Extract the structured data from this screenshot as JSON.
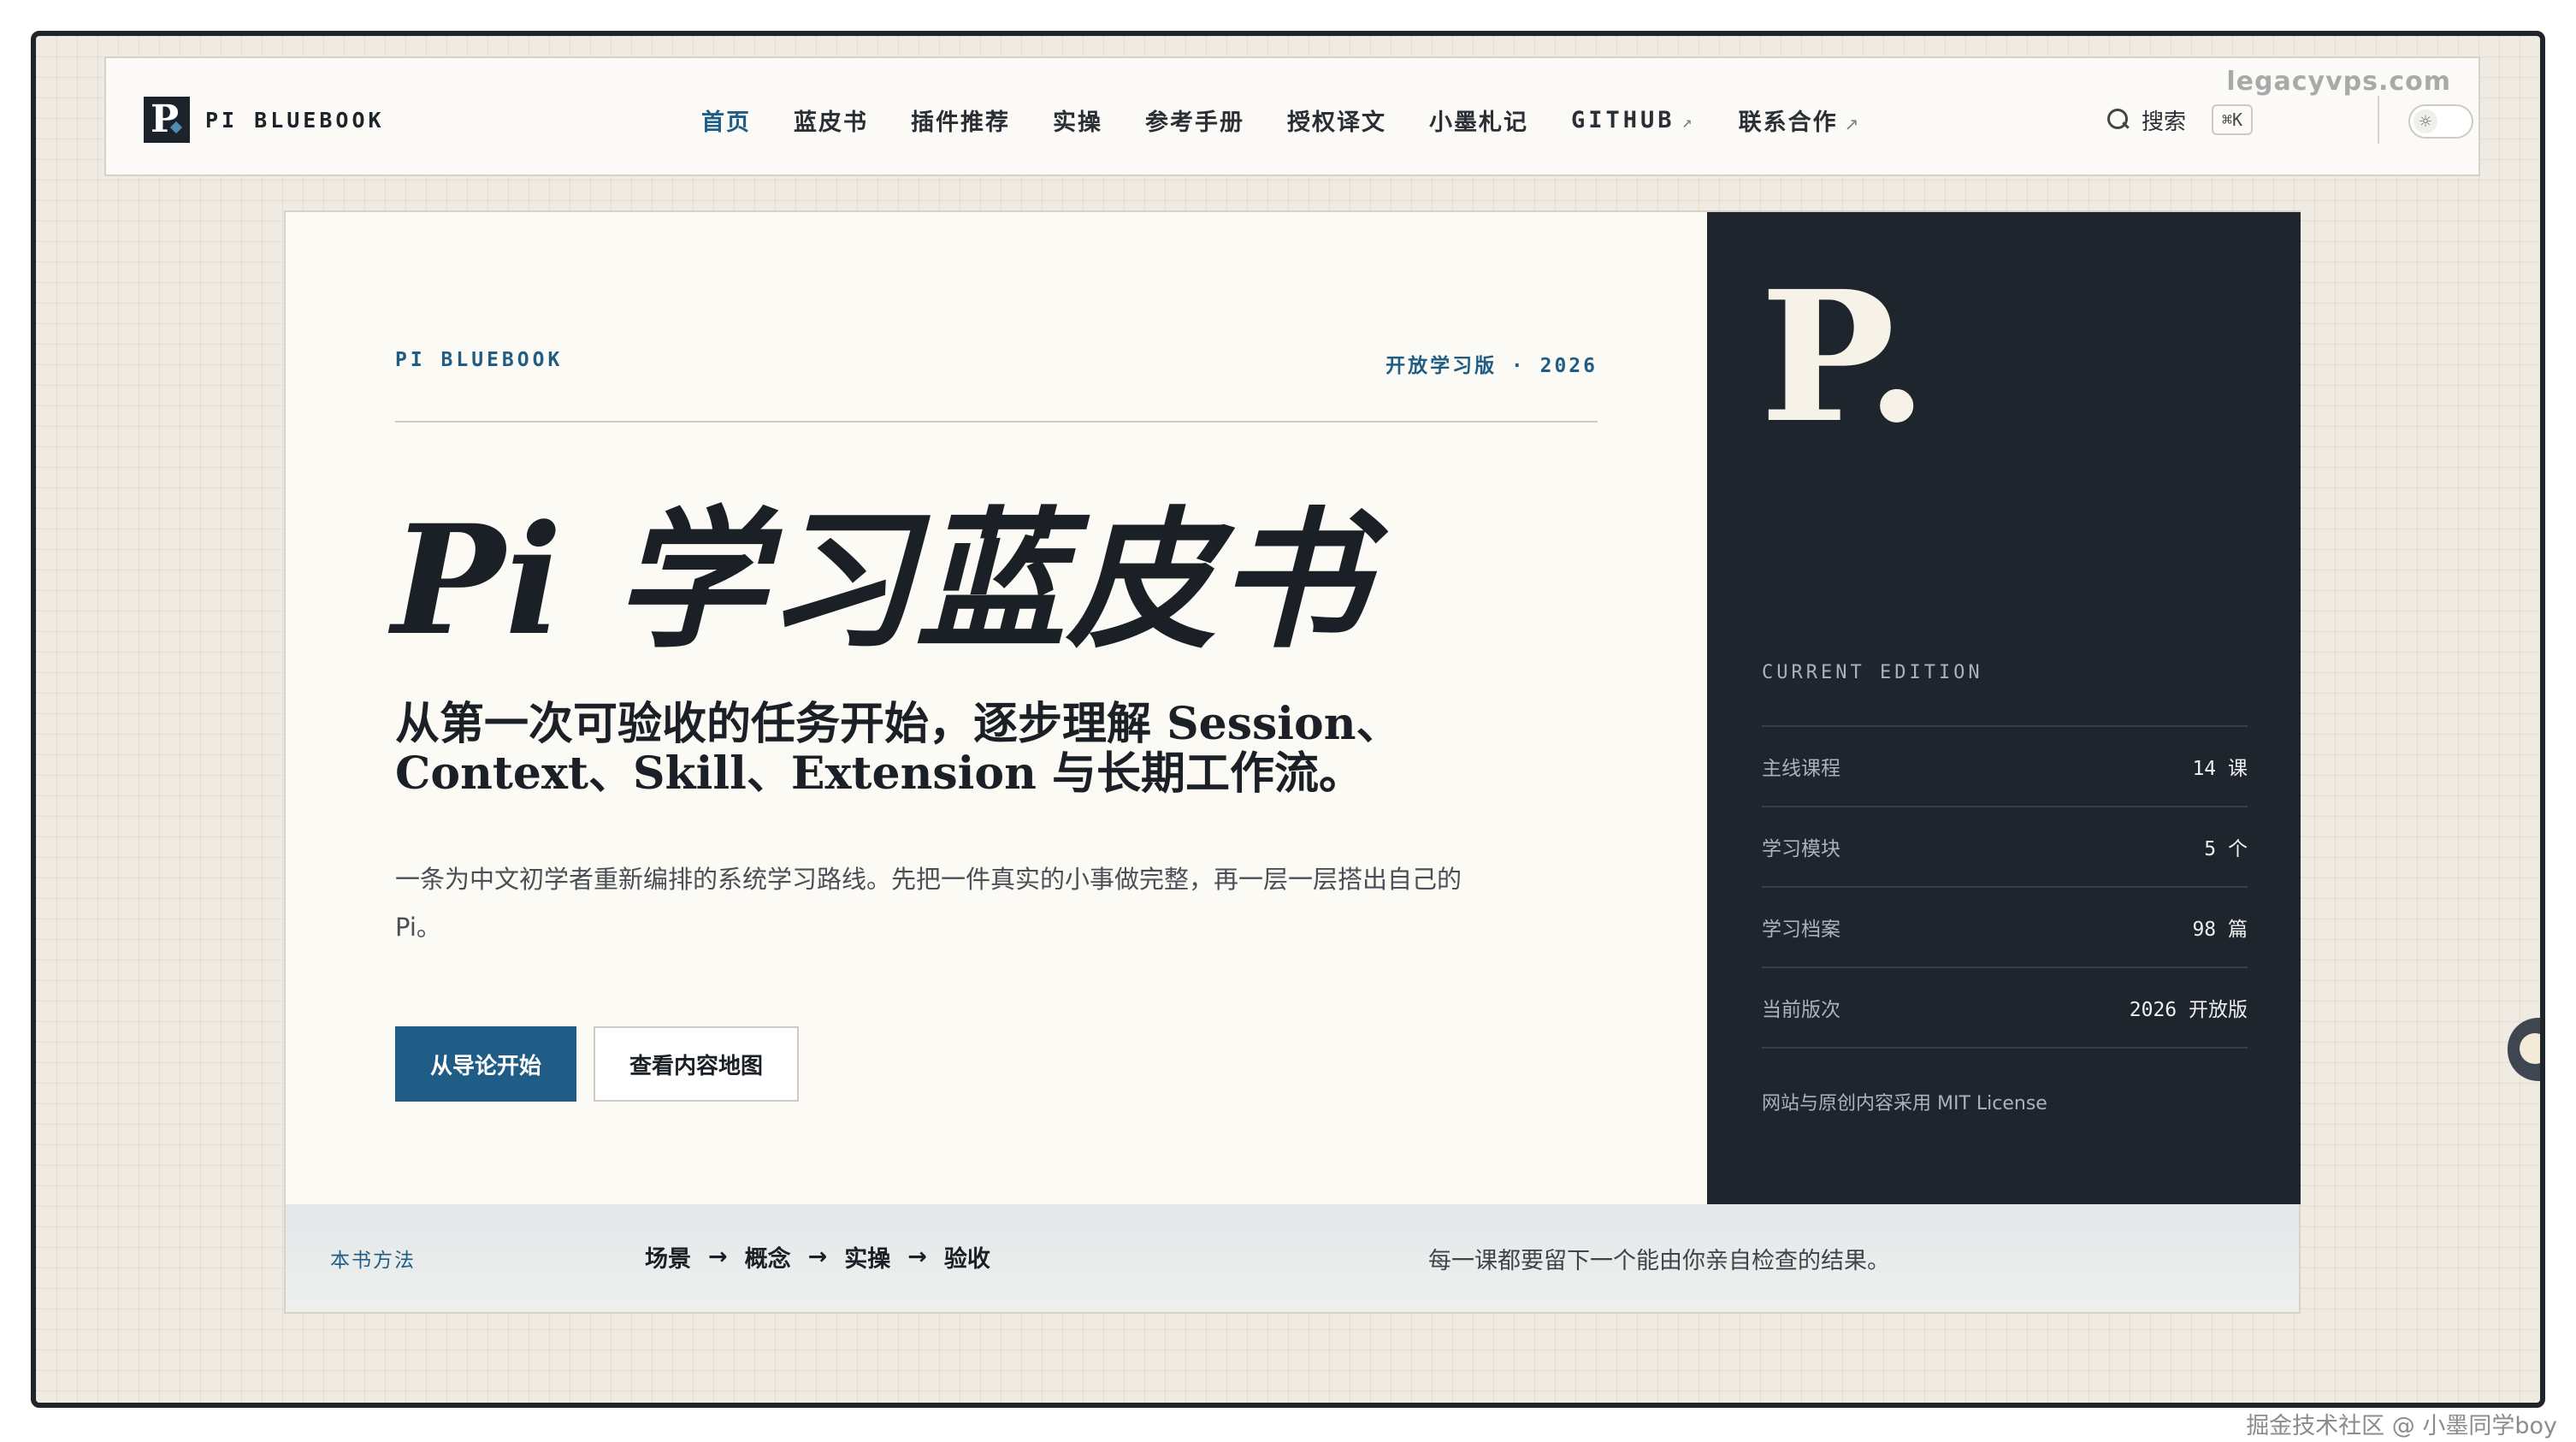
{
  "nav": {
    "brand_mark": "P",
    "brand_name": "PI BLUEBOOK",
    "items": [
      {
        "label": "首页",
        "active": true
      },
      {
        "label": "蓝皮书"
      },
      {
        "label": "插件推荐"
      },
      {
        "label": "实操"
      },
      {
        "label": "参考手册"
      },
      {
        "label": "授权译文"
      },
      {
        "label": "小墨札记"
      },
      {
        "label": "GITHUB",
        "external": "↗"
      },
      {
        "label": "联系合作",
        "external": "↗"
      }
    ],
    "search_label": "搜索",
    "shortcut": "⌘K",
    "theme_icon": "☼"
  },
  "hero": {
    "eyebrow": "PI BLUEBOOK",
    "edition": "开放学习版 · 2026",
    "title": "Pi 学习蓝皮书",
    "subtitle": "从第一次可验收的任务开始，逐步理解 Session、Context、Skill、Extension 与长期工作流。",
    "description": "一条为中文初学者重新编排的系统学习路线。先把一件真实的小事做完整，再一层一层搭出自己的 Pi。",
    "primary_button": "从导论开始",
    "secondary_button": "查看内容地图"
  },
  "panel": {
    "logo_letter": "P.",
    "label": "CURRENT EDITION",
    "stats": [
      {
        "label": "主线课程",
        "value": "14 课"
      },
      {
        "label": "学习模块",
        "value": "5 个"
      },
      {
        "label": "学习档案",
        "value": "98 篇"
      },
      {
        "label": "当前版次",
        "value": "2026 开放版"
      }
    ],
    "license": "网站与原创内容采用 MIT License"
  },
  "strip": {
    "label": "本书方法",
    "steps": [
      "场景",
      "概念",
      "实操",
      "验收"
    ],
    "arrow": "→",
    "note": "每一课都要留下一个能由你亲自检查的结果。"
  },
  "watermarks": {
    "top": "legacyvps.com",
    "bottom": "掘金技术社区 @ 小墨同学boy"
  },
  "colors": {
    "accent": "#1f5d86",
    "dark_panel": "#1e252c",
    "page_bg": "#efebe3",
    "card_bg": "#fbfaf5"
  }
}
